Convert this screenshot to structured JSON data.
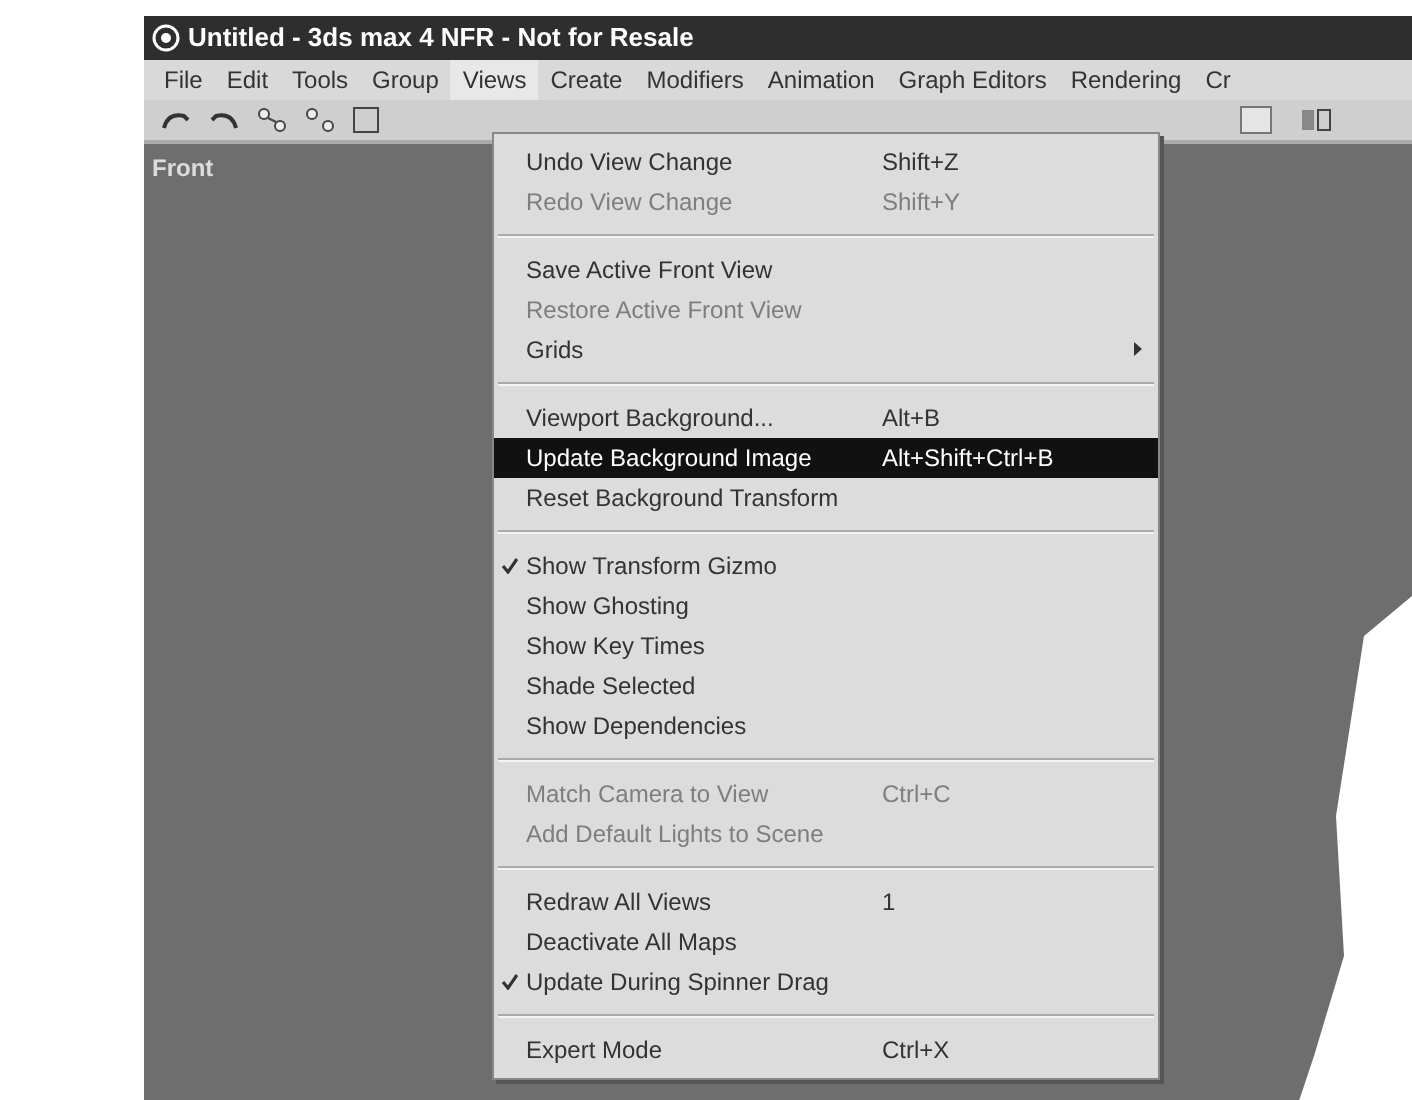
{
  "window": {
    "title": "Untitled - 3ds max 4 NFR - Not for Resale"
  },
  "menubar": [
    {
      "label": "File",
      "selected": false
    },
    {
      "label": "Edit",
      "selected": false
    },
    {
      "label": "Tools",
      "selected": false
    },
    {
      "label": "Group",
      "selected": false
    },
    {
      "label": "Views",
      "selected": true
    },
    {
      "label": "Create",
      "selected": false
    },
    {
      "label": "Modifiers",
      "selected": false
    },
    {
      "label": "Animation",
      "selected": false
    },
    {
      "label": "Graph Editors",
      "selected": false
    },
    {
      "label": "Rendering",
      "selected": false
    },
    {
      "label": "Cr",
      "selected": false
    }
  ],
  "viewport": {
    "label": "Front"
  },
  "menu": [
    {
      "kind": "item",
      "label": "Undo View Change",
      "shortcut": "Shift+Z",
      "disabled": false,
      "checked": false,
      "selected": false
    },
    {
      "kind": "item",
      "label": "Redo View Change",
      "shortcut": "Shift+Y",
      "disabled": true,
      "checked": false,
      "selected": false
    },
    {
      "kind": "separator"
    },
    {
      "kind": "item",
      "label": "Save Active Front View",
      "disabled": false,
      "checked": false,
      "selected": false
    },
    {
      "kind": "item",
      "label": "Restore Active Front View",
      "disabled": true,
      "checked": false,
      "selected": false
    },
    {
      "kind": "submenu",
      "label": "Grids",
      "disabled": false,
      "checked": false,
      "selected": false
    },
    {
      "kind": "separator"
    },
    {
      "kind": "item",
      "label": "Viewport Background...",
      "shortcut": "Alt+B",
      "disabled": false,
      "checked": false,
      "selected": false
    },
    {
      "kind": "item",
      "label": "Update Background Image",
      "shortcut": "Alt+Shift+Ctrl+B",
      "disabled": false,
      "checked": false,
      "selected": true
    },
    {
      "kind": "item",
      "label": "Reset Background Transform",
      "disabled": false,
      "checked": false,
      "selected": false
    },
    {
      "kind": "separator"
    },
    {
      "kind": "item",
      "label": "Show Transform Gizmo",
      "disabled": false,
      "checked": true,
      "selected": false
    },
    {
      "kind": "item",
      "label": "Show Ghosting",
      "disabled": false,
      "checked": false,
      "selected": false
    },
    {
      "kind": "item",
      "label": "Show Key Times",
      "disabled": false,
      "checked": false,
      "selected": false
    },
    {
      "kind": "item",
      "label": "Shade Selected",
      "disabled": false,
      "checked": false,
      "selected": false
    },
    {
      "kind": "item",
      "label": "Show Dependencies",
      "disabled": false,
      "checked": false,
      "selected": false
    },
    {
      "kind": "separator"
    },
    {
      "kind": "item",
      "label": "Match Camera to View",
      "shortcut": "Ctrl+C",
      "disabled": true,
      "checked": false,
      "selected": false
    },
    {
      "kind": "item",
      "label": "Add Default Lights to Scene",
      "disabled": true,
      "checked": false,
      "selected": false
    },
    {
      "kind": "separator"
    },
    {
      "kind": "item",
      "label": "Redraw All Views",
      "shortcut": "1",
      "disabled": false,
      "checked": false,
      "selected": false
    },
    {
      "kind": "item",
      "label": "Deactivate All Maps",
      "disabled": false,
      "checked": false,
      "selected": false
    },
    {
      "kind": "item",
      "label": "Update During Spinner Drag",
      "disabled": false,
      "checked": true,
      "selected": false
    },
    {
      "kind": "separator"
    },
    {
      "kind": "item",
      "label": "Expert Mode",
      "shortcut": "Ctrl+X",
      "disabled": false,
      "checked": false,
      "selected": false
    }
  ]
}
